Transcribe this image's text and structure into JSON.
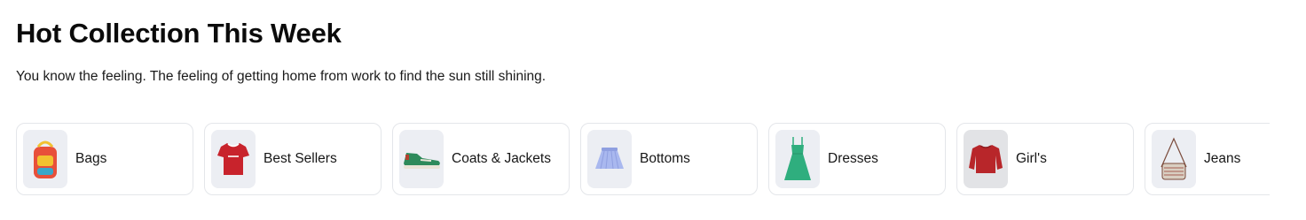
{
  "section": {
    "title": "Hot Collection This Week",
    "subtitle": "You know the feeling. The feeling of getting home from work to find the sun still shining."
  },
  "categories": [
    {
      "label": "Bags",
      "icon": "backpack-icon",
      "colors": [
        "#e8503a",
        "#f2c230",
        "#3aa7c9"
      ]
    },
    {
      "label": "Best Sellers",
      "icon": "tshirt-icon",
      "colors": [
        "#c8232c"
      ]
    },
    {
      "label": "Coats & Jackets",
      "icon": "sneaker-icon",
      "colors": [
        "#2e8a5b",
        "#e9e3d6",
        "#b5402f"
      ]
    },
    {
      "label": "Bottoms",
      "icon": "skirt-icon",
      "colors": [
        "#a9b8ef"
      ]
    },
    {
      "label": "Dresses",
      "icon": "dress-icon",
      "colors": [
        "#2fae7e"
      ]
    },
    {
      "label": "Girl's",
      "icon": "sweater-icon",
      "colors": [
        "#b8262a"
      ]
    },
    {
      "label": "Jeans",
      "icon": "crossbody-bag-icon",
      "colors": [
        "#7a4a3a",
        "#d9cfc2"
      ]
    }
  ]
}
